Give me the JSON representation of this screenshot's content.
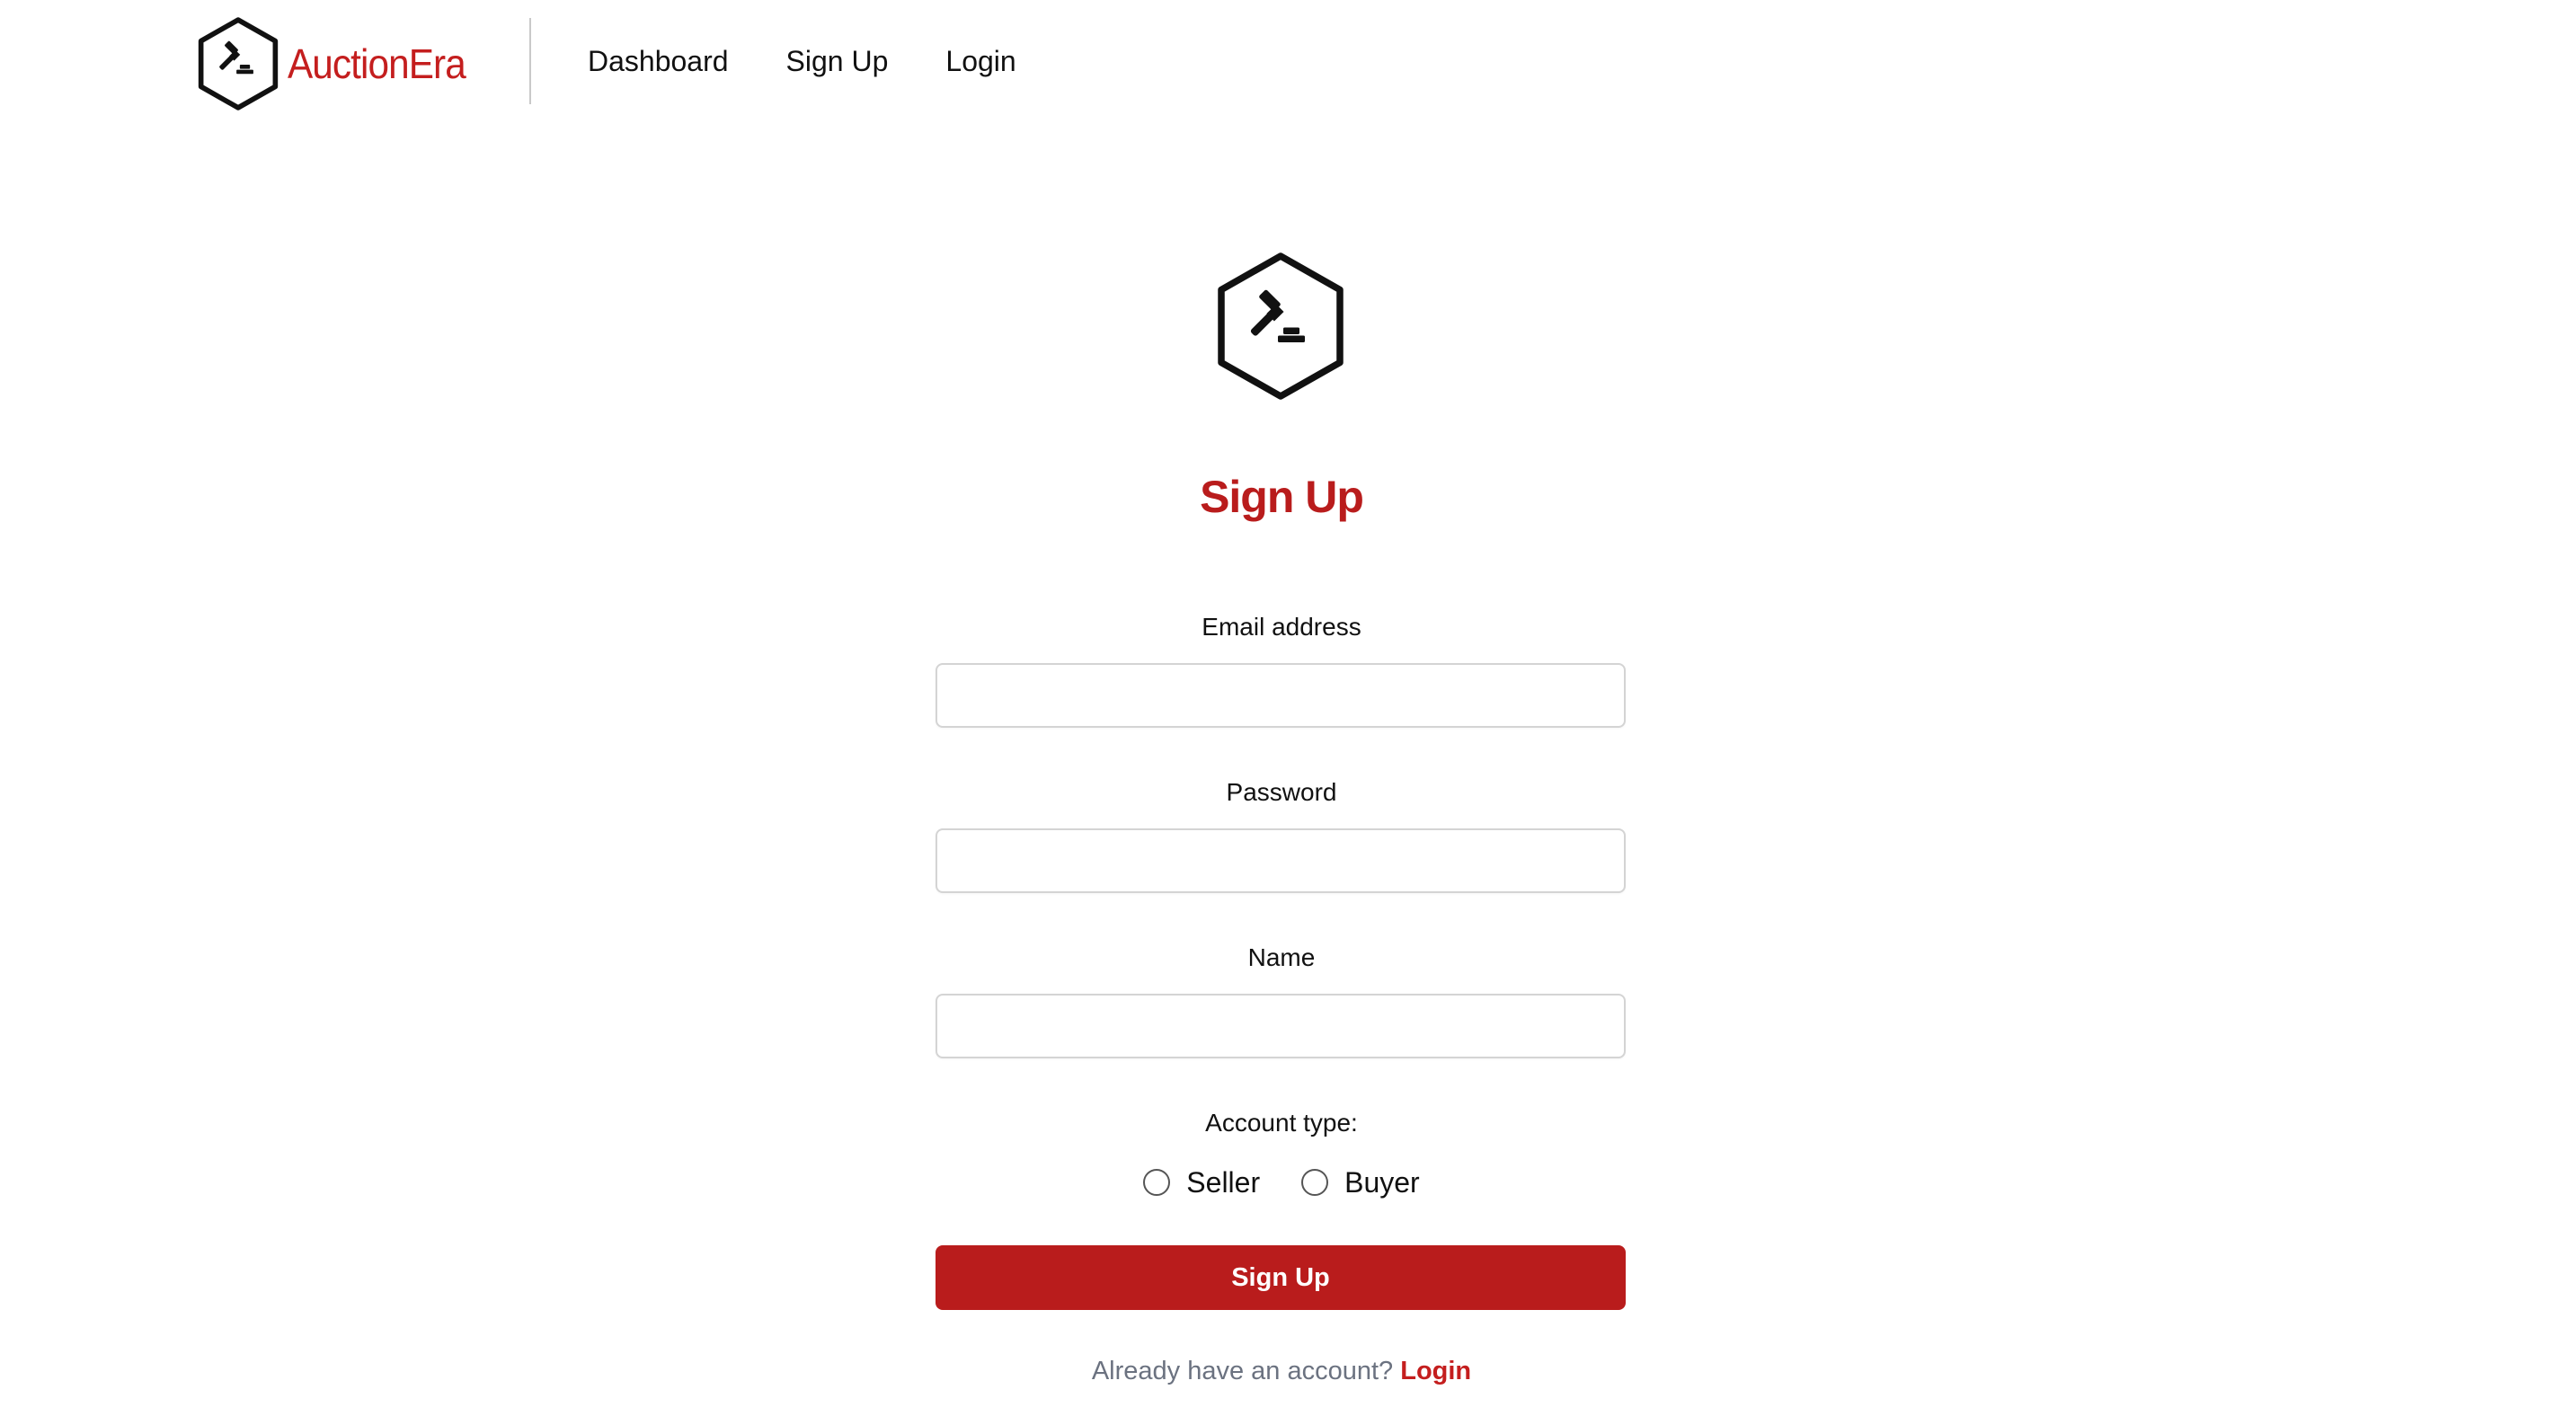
{
  "brand": {
    "name": "AuctionEra",
    "logo_icon": "gavel-hexagon-icon",
    "color": "#c41e1e"
  },
  "nav": {
    "items": [
      {
        "label": "Dashboard"
      },
      {
        "label": "Sign Up"
      },
      {
        "label": "Login"
      }
    ]
  },
  "form": {
    "logo_icon": "gavel-hexagon-icon",
    "title": "Sign Up",
    "title_color": "#b91c1c",
    "email": {
      "label": "Email address",
      "value": "",
      "placeholder": ""
    },
    "password": {
      "label": "Password",
      "value": "",
      "placeholder": ""
    },
    "name": {
      "label": "Name",
      "value": "",
      "placeholder": ""
    },
    "account_type": {
      "label": "Account type:",
      "options": [
        {
          "label": "Seller",
          "selected": false
        },
        {
          "label": "Buyer",
          "selected": false
        }
      ]
    },
    "submit_label": "Sign Up",
    "submit_color": "#b91c1c"
  },
  "footer": {
    "prompt": "Already have an account?",
    "link_label": "Login"
  }
}
